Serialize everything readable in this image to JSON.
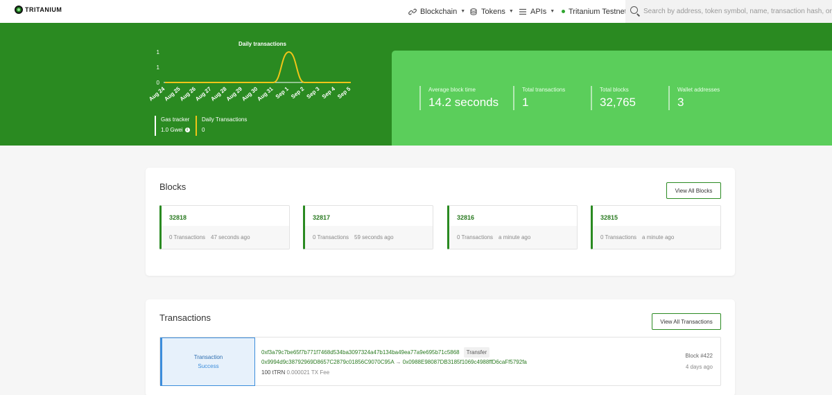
{
  "brand": {
    "name": "TRITANIUM"
  },
  "nav": {
    "items": [
      {
        "label": "Blockchain",
        "icon": "link-icon"
      },
      {
        "label": "Tokens",
        "icon": "coins-icon"
      },
      {
        "label": "APIs",
        "icon": "menu-icon"
      }
    ],
    "network": "Tritanium Testnet",
    "search_placeholder": "Search by address, token symbol, name, transaction hash, or block number"
  },
  "hero": {
    "gas_tracker": {
      "label": "Gas tracker",
      "value": "1.0 Gwei"
    },
    "daily_transactions": {
      "label": "Daily Transactions",
      "value": "0"
    },
    "stats": [
      {
        "label": "Average block time",
        "value": "14.2 seconds"
      },
      {
        "label": "Total transactions",
        "value": "1"
      },
      {
        "label": "Total blocks",
        "value": "32,765"
      },
      {
        "label": "Wallet addresses",
        "value": "3"
      }
    ]
  },
  "chart_data": {
    "type": "line",
    "title": "Daily transactions",
    "categories": [
      "Aug 24",
      "Aug 25",
      "Aug 26",
      "Aug 27",
      "Aug 28",
      "Aug 29",
      "Aug 30",
      "Aug 31",
      "Sep 1",
      "Sep 2",
      "Sep 3",
      "Sep 4",
      "Sep 5"
    ],
    "series": [
      {
        "values": [
          0,
          0,
          0,
          0,
          0,
          0,
          0,
          0,
          1,
          0,
          0,
          0,
          0
        ]
      }
    ],
    "y_ticks": [
      "1",
      "1",
      "0"
    ],
    "ylim": [
      0,
      1
    ],
    "grid": false,
    "colors": {
      "line": "#f0c419",
      "axis": "#ffffff",
      "text": "#ffffff"
    }
  },
  "blocks": {
    "title": "Blocks",
    "view_all": "View All Blocks",
    "items": [
      {
        "number": "32818",
        "tx": "0 Transactions",
        "age": "47 seconds ago"
      },
      {
        "number": "32817",
        "tx": "0 Transactions",
        "age": "59 seconds ago"
      },
      {
        "number": "32816",
        "tx": "0 Transactions",
        "age": "a minute ago"
      },
      {
        "number": "32815",
        "tx": "0 Transactions",
        "age": "a minute ago"
      }
    ]
  },
  "transactions": {
    "title": "Transactions",
    "view_all": "View All Transactions",
    "items": [
      {
        "type": "Transaction",
        "status": "Success",
        "hash": "0xf3a79c7be65f7b771f7468d534ba3097324a47b134ba49ea77a9e695b71c5868",
        "tag": "Transfer",
        "from": "0x9994d9c38792969D8657C2879c01856C9070C95A",
        "arrow": "→",
        "to": "0x0988E98087DB3185f1069c4988ffD6caFf5792fa",
        "amount": "100 tTRN",
        "fee": "0.000021 TX Fee",
        "block": "Block #422",
        "age": "4 days ago"
      }
    ]
  },
  "colors": {
    "hero_green": "#2a8a21",
    "stats_green": "#5bce5b",
    "accent_yellow": "#f0c419",
    "status_blue": "#3c8ddb"
  }
}
